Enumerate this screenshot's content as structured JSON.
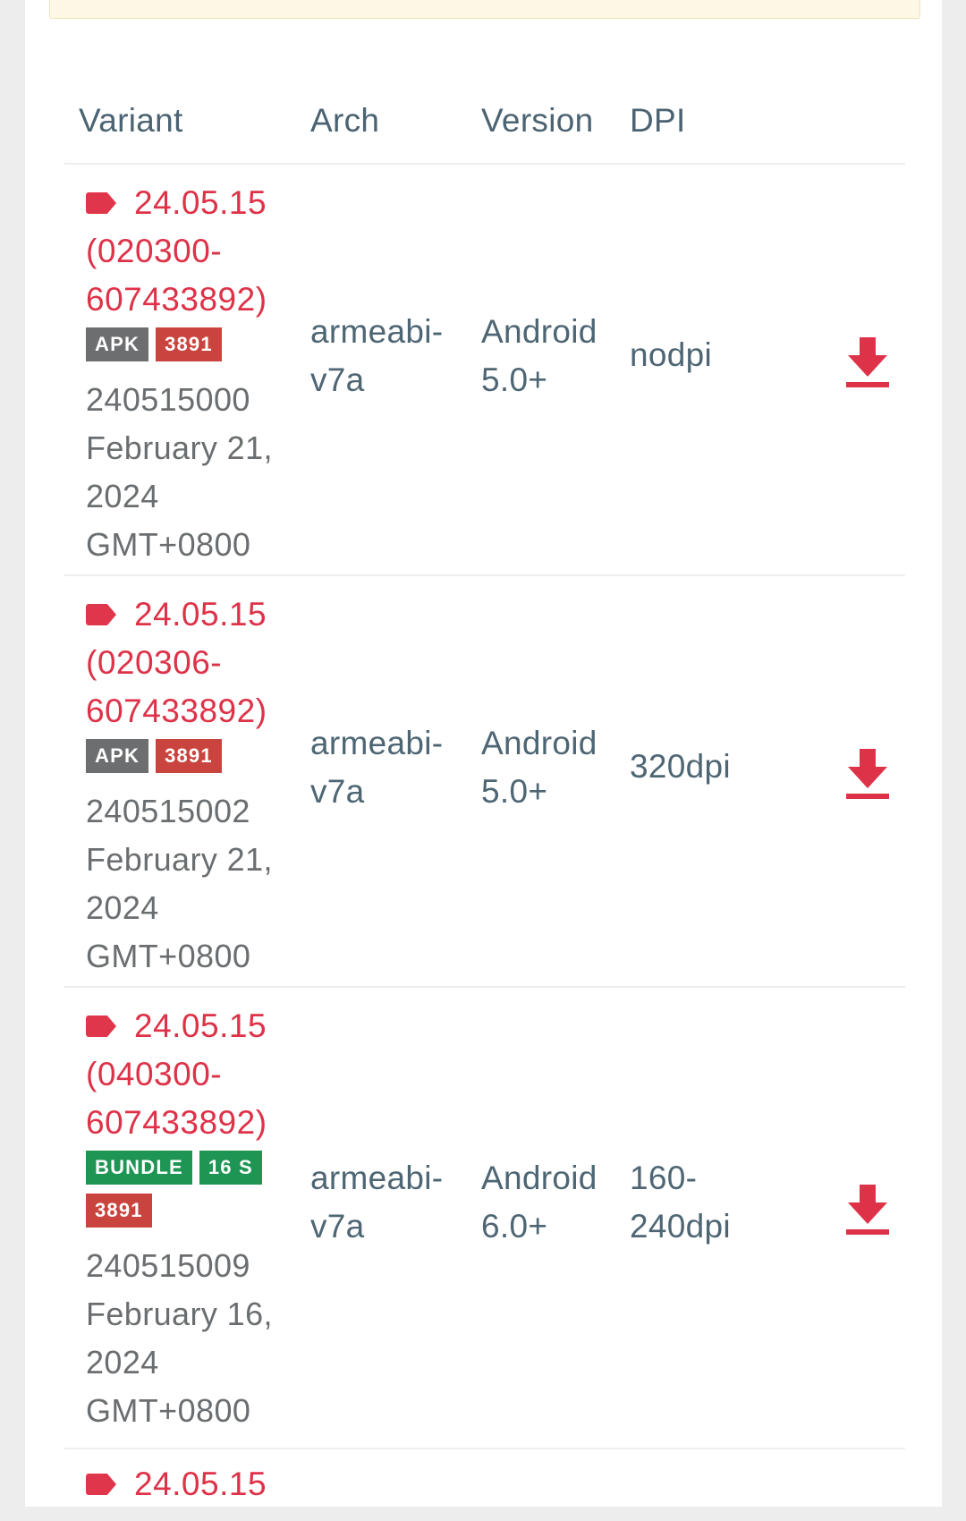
{
  "table": {
    "headers": {
      "variant": "Variant",
      "arch": "Arch",
      "version": "Version",
      "dpi": "DPI"
    },
    "rows": [
      {
        "variant_line1": "24.05.15",
        "variant_line2": "(020300-",
        "variant_line3": "607433892)",
        "badges": [
          "APK",
          "3891"
        ],
        "version_code": "240515000",
        "date_line1": "February 21,",
        "date_line2": "2024",
        "timezone": "GMT+0800",
        "arch_line1": "armeabi-",
        "arch_line2": "v7a",
        "version_line1": "Android",
        "version_line2": "5.0+",
        "dpi_line1": "nodpi",
        "dpi_line2": ""
      },
      {
        "variant_line1": "24.05.15",
        "variant_line2": "(020306-",
        "variant_line3": "607433892)",
        "badges": [
          "APK",
          "3891"
        ],
        "version_code": "240515002",
        "date_line1": "February 21,",
        "date_line2": "2024",
        "timezone": "GMT+0800",
        "arch_line1": "armeabi-",
        "arch_line2": "v7a",
        "version_line1": "Android",
        "version_line2": "5.0+",
        "dpi_line1": "320dpi",
        "dpi_line2": ""
      },
      {
        "variant_line1": "24.05.15",
        "variant_line2": "(040300-",
        "variant_line3": "607433892)",
        "badges": [
          "BUNDLE",
          "16 S",
          "3891"
        ],
        "version_code": "240515009",
        "date_line1": "February 16,",
        "date_line2": "2024",
        "timezone": "GMT+0800",
        "arch_line1": "armeabi-",
        "arch_line2": "v7a",
        "version_line1": "Android",
        "version_line2": "6.0+",
        "dpi_line1": "160-",
        "dpi_line2": "240dpi"
      },
      {
        "variant_line1": "24.05.15"
      }
    ]
  },
  "icons": {
    "variant_tag": "tag-icon",
    "download": "download-icon"
  },
  "colors": {
    "accent_red": "#de3248",
    "apk_badge": "#6d6e70",
    "number_badge": "#c9443e",
    "bundle_badge": "#1e9553",
    "notice_bg": "#fdf8e6"
  }
}
